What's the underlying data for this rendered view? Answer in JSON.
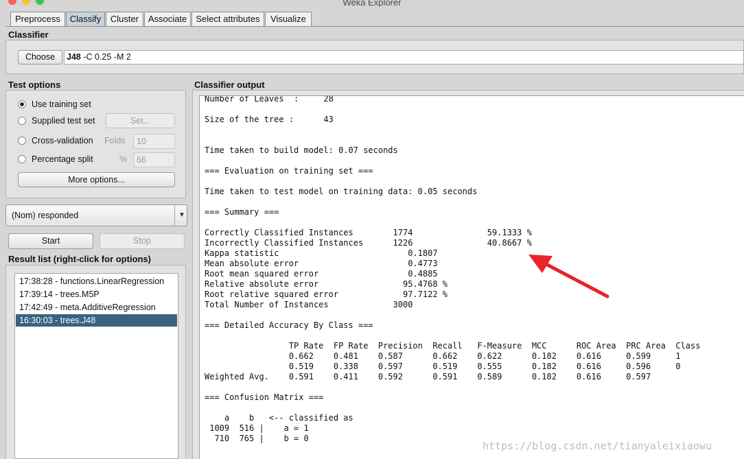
{
  "window": {
    "title": "Weka Explorer"
  },
  "tabs": [
    "Preprocess",
    "Classify",
    "Cluster",
    "Associate",
    "Select attributes",
    "Visualize"
  ],
  "classifier": {
    "section_title": "Classifier",
    "choose_label": "Choose",
    "name": "J48",
    "options": "-C 0.25 -M 2"
  },
  "test_options": {
    "section_title": "Test options",
    "use_training_set": "Use training set",
    "supplied_test_set": "Supplied test set",
    "set_button": "Set...",
    "cross_validation": "Cross-validation",
    "folds_label": "Folds",
    "folds_value": "10",
    "percentage_split": "Percentage split",
    "percent_label": "%",
    "percent_value": "66",
    "more_options": "More options...",
    "selected": "Use training set"
  },
  "class_attribute": "(Nom) responded",
  "start_label": "Start",
  "stop_label": "Stop",
  "result_list": {
    "title": "Result list (right-click for options)",
    "items": [
      "17:38:28 - functions.LinearRegression",
      "17:39:14 - trees.M5P",
      "17:42:49 - meta.AdditiveRegression",
      "16:30:03 - trees.J48"
    ],
    "selected_index": 3
  },
  "output": {
    "title": "Classifier output",
    "lines": [
      "Number of Leaves  :     28",
      "",
      "Size of the tree :      43",
      "",
      "",
      "Time taken to build model: 0.07 seconds",
      "",
      "=== Evaluation on training set ===",
      "",
      "Time taken to test model on training data: 0.05 seconds",
      "",
      "=== Summary ===",
      "",
      "Correctly Classified Instances        1774               59.1333 %",
      "Incorrectly Classified Instances      1226               40.8667 %",
      "Kappa statistic                          0.1807",
      "Mean absolute error                      0.4773",
      "Root mean squared error                  0.4885",
      "Relative absolute error                 95.4768 %",
      "Root relative squared error             97.7122 %",
      "Total Number of Instances             3000",
      "",
      "=== Detailed Accuracy By Class ===",
      "",
      "                 TP Rate  FP Rate  Precision  Recall   F-Measure  MCC      ROC Area  PRC Area  Class",
      "                 0.662    0.481    0.587      0.662    0.622      0.182    0.616     0.599     1",
      "                 0.519    0.338    0.597      0.519    0.555      0.182    0.616     0.596     0",
      "Weighted Avg.    0.591    0.411    0.592      0.591    0.589      0.182    0.616     0.597",
      "",
      "=== Confusion Matrix ===",
      "",
      "    a    b   <-- classified as",
      " 1009  516 |    a = 1",
      "  710  765 |    b = 0"
    ]
  },
  "watermark": "https://blog.csdn.net/tianyaleixiaowu",
  "colors": {
    "selection": "#39627f",
    "arrow": "#e8232a",
    "active_tab": "#c9d3dc"
  }
}
